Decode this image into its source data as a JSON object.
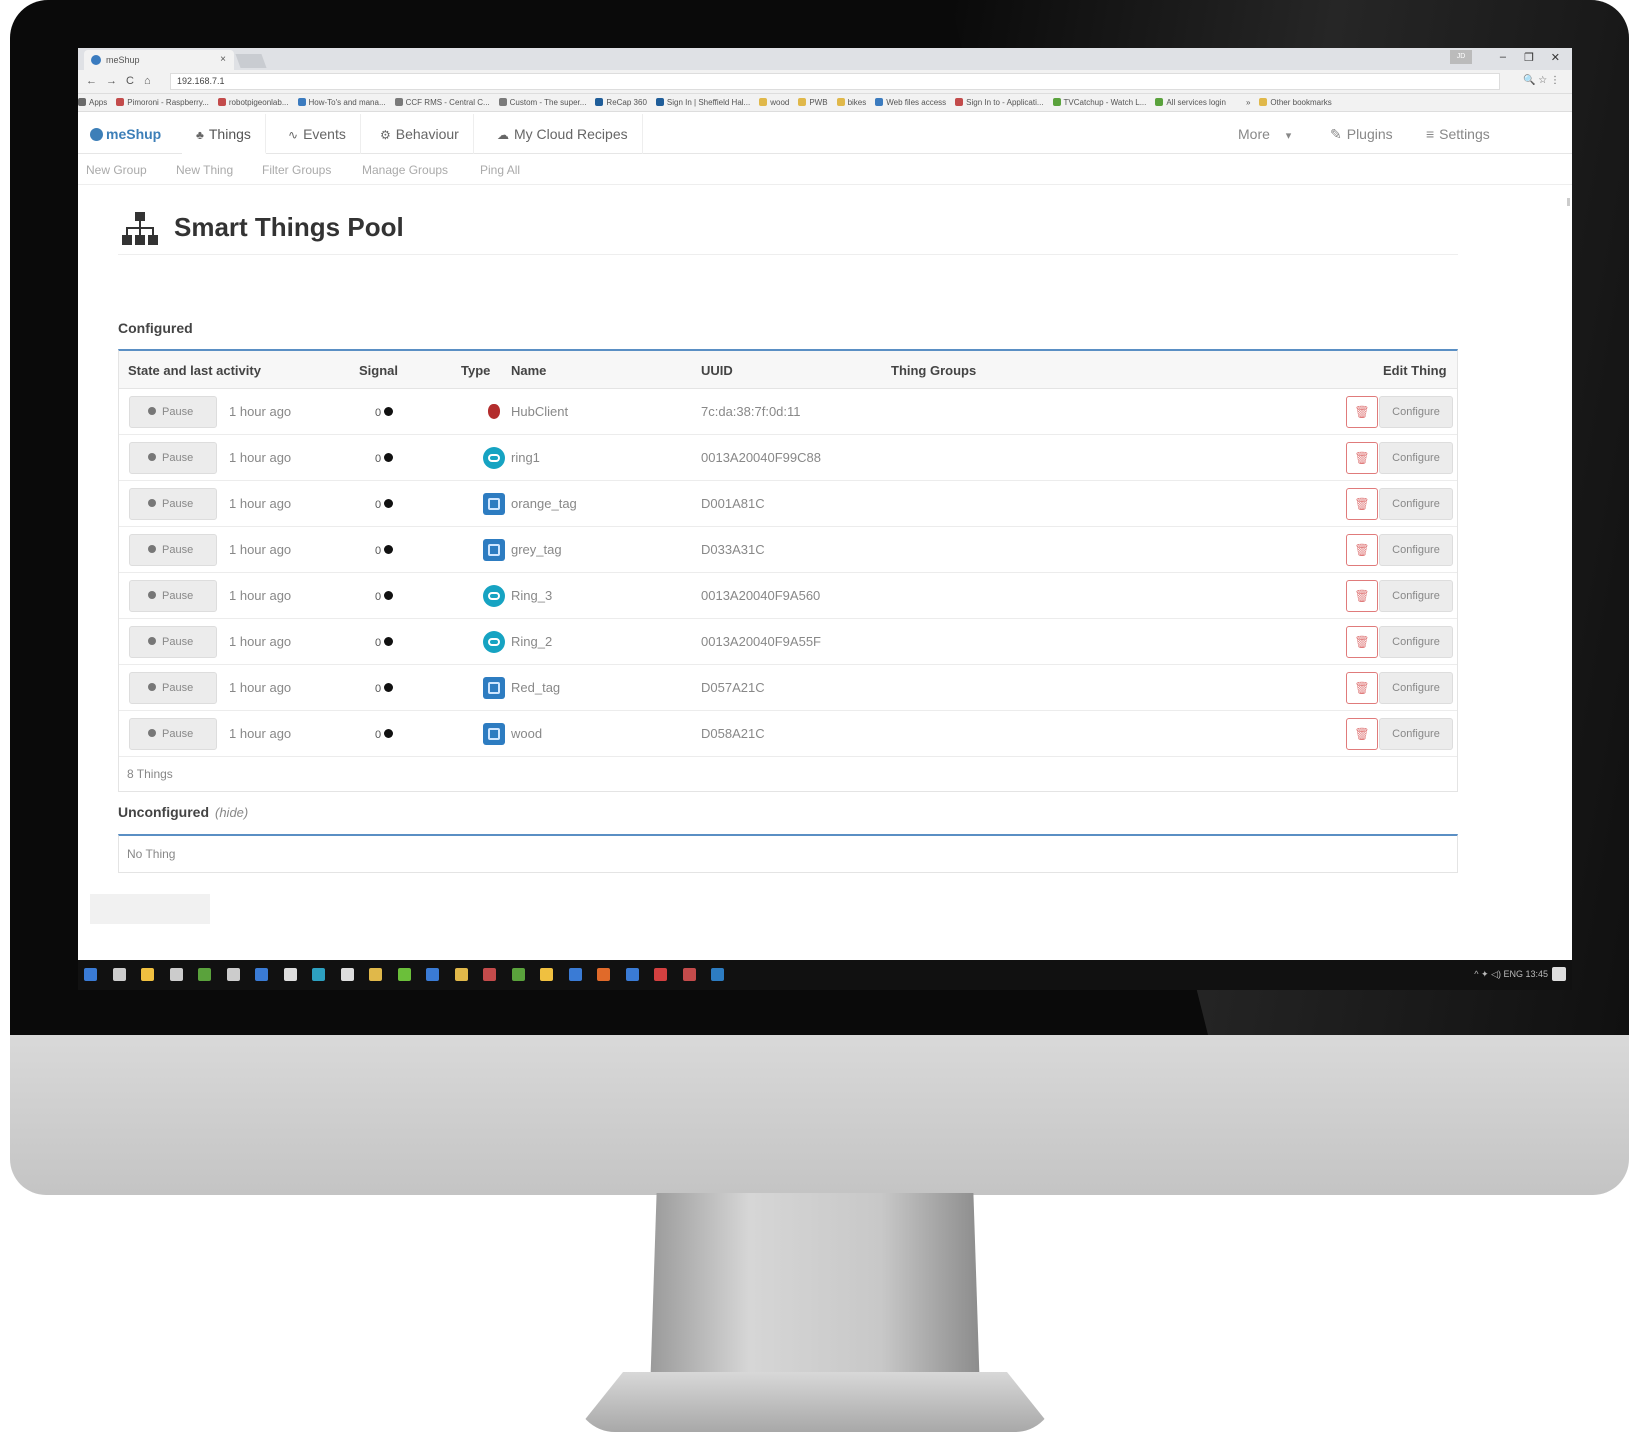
{
  "browser": {
    "tab_title": "meShup",
    "tab_close": "×",
    "window_controls": [
      "–",
      "❐",
      "✕"
    ],
    "user_badge": "JD",
    "url": "192.168.7.1",
    "nav_glyphs": [
      "←",
      "→",
      "C",
      "⌂"
    ],
    "addr_icons": "🔍 ☆ ⋮",
    "bookmarks": [
      {
        "label": "Apps",
        "color": "#6a6a6a"
      },
      {
        "label": "Pimoroni - Raspberry...",
        "color": "#c34b4b"
      },
      {
        "label": "robotpigeonlab...",
        "color": "#c34b4b"
      },
      {
        "label": "How-To's and mana...",
        "color": "#3b7bbf"
      },
      {
        "label": "CCF RMS - Central C...",
        "color": "#7a7a7a"
      },
      {
        "label": "Custom - The super...",
        "color": "#7a7a7a"
      },
      {
        "label": "ReCap 360",
        "color": "#1f5d99"
      },
      {
        "label": "Sign In | Sheffield Hal...",
        "color": "#1f5d99"
      },
      {
        "label": "wood",
        "color": "#e0b84a"
      },
      {
        "label": "PWB",
        "color": "#e0b84a"
      },
      {
        "label": "bikes",
        "color": "#e0b84a"
      },
      {
        "label": "Web files access",
        "color": "#3b7bbf"
      },
      {
        "label": "Sign In to - Applicati...",
        "color": "#c34b4b"
      },
      {
        "label": "TVCatchup - Watch L...",
        "color": "#5aa23c"
      },
      {
        "label": "All services login",
        "color": "#5aa23c"
      },
      {
        "label": "»",
        "color": "#f2f2f2"
      },
      {
        "label": "Other bookmarks",
        "color": "#e0b84a"
      }
    ]
  },
  "app": {
    "brand": "meShup",
    "nav": [
      {
        "label": "Things",
        "icon": "sitemap-icon",
        "glyph": "♣"
      },
      {
        "label": "Events",
        "icon": "feed-icon",
        "glyph": "∿"
      },
      {
        "label": "Behaviour",
        "icon": "cogs-icon",
        "glyph": "⚙"
      },
      {
        "label": "My Cloud Recipes",
        "icon": "cloud-icon",
        "glyph": "☁"
      }
    ],
    "nav_right": {
      "more": "More",
      "more_caret": "▾",
      "plugins": "Plugins",
      "plugins_glyph": "✎",
      "settings": "Settings",
      "settings_glyph": "≡"
    },
    "subnav": [
      "New Group",
      "New Thing",
      "Filter Groups",
      "Manage Groups",
      "Ping All"
    ]
  },
  "page": {
    "title": "Smart Things Pool",
    "configured": {
      "label": "Configured",
      "columns": {
        "state": "State and last activity",
        "signal": "Signal",
        "type": "Type",
        "name": "Name",
        "uuid": "UUID",
        "groups": "Thing Groups",
        "edit": "Edit Thing"
      },
      "rows": [
        {
          "button": "Pause",
          "activity": "1 hour ago",
          "signal": "0",
          "type": "pi",
          "name": "HubClient",
          "uuid": "7c:da:38:7f:0d:11",
          "configure": "Configure"
        },
        {
          "button": "Pause",
          "activity": "1 hour ago",
          "signal": "0",
          "type": "ring",
          "name": "ring1",
          "uuid": "0013A20040F99C88",
          "configure": "Configure"
        },
        {
          "button": "Pause",
          "activity": "1 hour ago",
          "signal": "0",
          "type": "tag",
          "name": "orange_tag",
          "uuid": "D001A81C",
          "configure": "Configure"
        },
        {
          "button": "Pause",
          "activity": "1 hour ago",
          "signal": "0",
          "type": "tag",
          "name": "grey_tag",
          "uuid": "D033A31C",
          "configure": "Configure"
        },
        {
          "button": "Pause",
          "activity": "1 hour ago",
          "signal": "0",
          "type": "ring",
          "name": "Ring_3",
          "uuid": "0013A20040F9A560",
          "configure": "Configure"
        },
        {
          "button": "Pause",
          "activity": "1 hour ago",
          "signal": "0",
          "type": "ring",
          "name": "Ring_2",
          "uuid": "0013A20040F9A55F",
          "configure": "Configure"
        },
        {
          "button": "Pause",
          "activity": "1 hour ago",
          "signal": "0",
          "type": "tag",
          "name": "Red_tag",
          "uuid": "D057A21C",
          "configure": "Configure"
        },
        {
          "button": "Pause",
          "activity": "1 hour ago",
          "signal": "0",
          "type": "tag",
          "name": "wood",
          "uuid": "D058A21C",
          "configure": "Configure"
        }
      ],
      "delete_glyph": "🗑",
      "footer": "8 Things"
    },
    "unconfigured": {
      "label": "Unconfigured",
      "hint": "(hide)",
      "empty": "No Thing"
    }
  },
  "taskbar": {
    "icon_colors": [
      "#3a7bd5",
      "#cccccc",
      "#f0c040",
      "#cccccc",
      "#5aa23c",
      "#cccccc",
      "#3a7bd5",
      "#dddddd",
      "#2da0c0",
      "#dddddd",
      "#e0b84a",
      "#6bbf3a",
      "#3a7bd5",
      "#e0b84a",
      "#c34b4b",
      "#5aa23c",
      "#f0c040",
      "#3a7bd5",
      "#e06a2a",
      "#3a7bd5",
      "#d34040",
      "#c34b4b",
      "#2d7cc1"
    ],
    "tray_text": "^ ✦ ◁) ENG 13:45"
  },
  "colors": {
    "accent": "#5a8fc4",
    "brand": "#3d7fb8",
    "danger": "#e07b7b"
  }
}
